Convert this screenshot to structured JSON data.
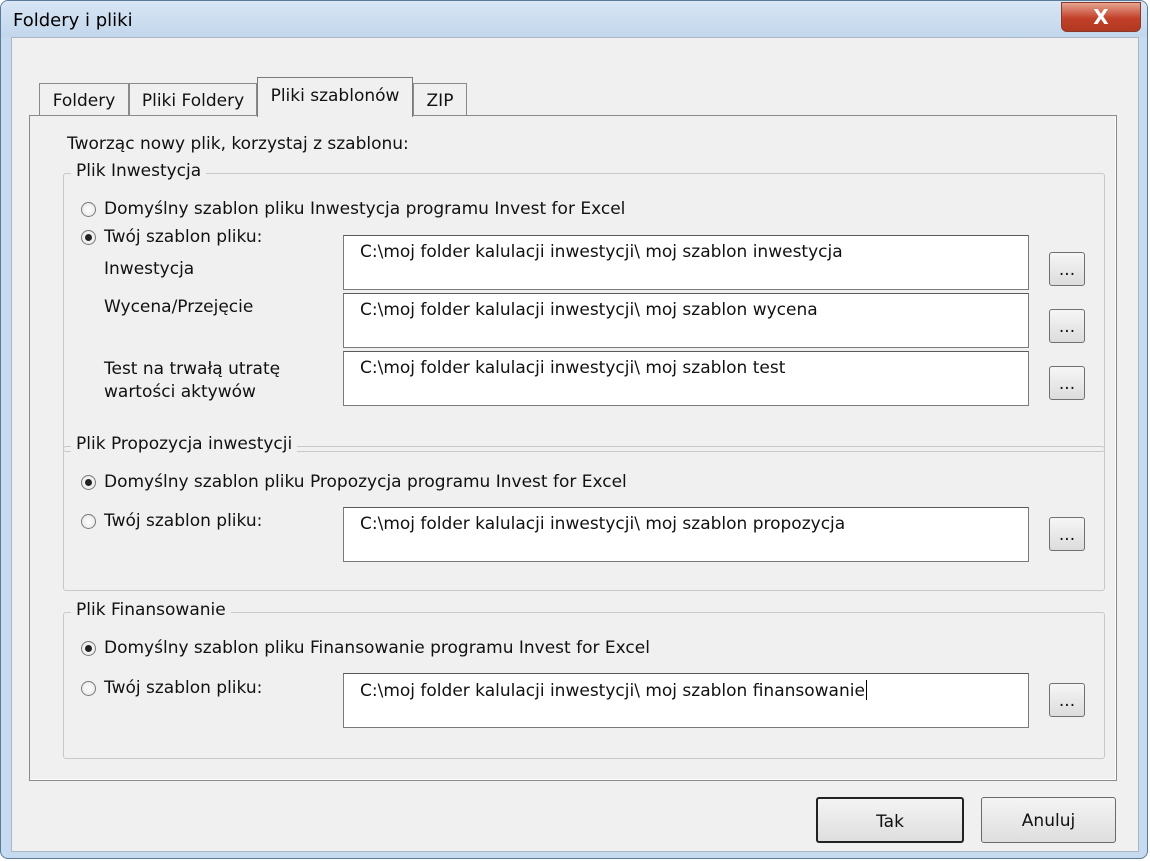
{
  "window": {
    "title": "Foldery i pliki",
    "close_label": "X"
  },
  "tabs": [
    {
      "label": "Foldery"
    },
    {
      "label": "Pliki Foldery"
    },
    {
      "label": "Pliki szablonów"
    },
    {
      "label": "ZIP"
    }
  ],
  "active_tab": "Pliki szablonów",
  "panel": {
    "intro": "Tworząc nowy plik, korzystaj z szablonu:",
    "inwestycja": {
      "legend": "Plik Inwestycja",
      "default_option": "Domyślny szablon pliku Inwestycja programu Invest for Excel",
      "custom_option": "Twój szablon pliku:",
      "selected": "custom",
      "rows": [
        {
          "label": "Inwestycja",
          "value": "C:\\moj folder kalulacji inwestycji\\ moj szablon inwestycja"
        },
        {
          "label": "Wycena/Przejęcie",
          "value": "C:\\moj folder kalulacji inwestycji\\ moj szablon wycena"
        },
        {
          "label": "Test na trwałą utratę",
          "label2": "wartości aktywów",
          "value": "C:\\moj folder kalulacji inwestycji\\ moj szablon test"
        }
      ]
    },
    "propozycja": {
      "legend": "Plik Propozycja inwestycji",
      "default_option": "Domyślny szablon pliku Propozycja programu Invest for Excel",
      "custom_option": "Twój szablon pliku:",
      "selected": "default",
      "value": "C:\\moj folder kalulacji inwestycji\\ moj szablon propozycja"
    },
    "finansowanie": {
      "legend": "Plik Finansowanie",
      "default_option": "Domyślny szablon pliku Finansowanie programu Invest for Excel",
      "custom_option": "Twój szablon pliku:",
      "selected": "default",
      "value": "C:\\moj folder kalulacji inwestycji\\ moj szablon finansowanie"
    },
    "browse_label": "..."
  },
  "buttons": {
    "ok": "Tak",
    "cancel": "Anuluj"
  }
}
